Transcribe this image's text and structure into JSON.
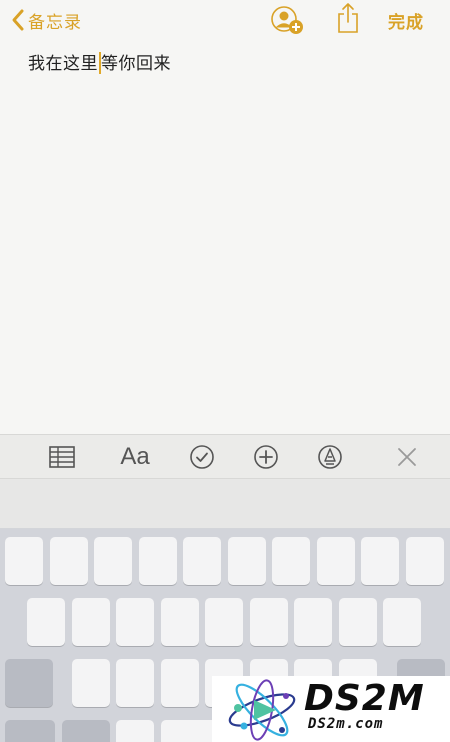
{
  "nav": {
    "back_label": "备忘录",
    "done_label": "完成",
    "collab_icon": "person-add-icon",
    "share_icon": "share-icon"
  },
  "note": {
    "text_before_cursor": "我在这里",
    "text_after_cursor": "等你回来"
  },
  "toolbar": {
    "items": [
      "table-icon",
      "text-format",
      "checklist-icon",
      "add-icon",
      "markup-icon",
      "close-icon"
    ],
    "format_label": "Aa"
  },
  "watermark": {
    "main": "DS2M",
    "sub": "DS2m.com"
  },
  "colors": {
    "accent": "#d9a227",
    "background": "#f6f6f4",
    "toolbar": "#ebebe9",
    "keyboard": "#d2d4da"
  }
}
